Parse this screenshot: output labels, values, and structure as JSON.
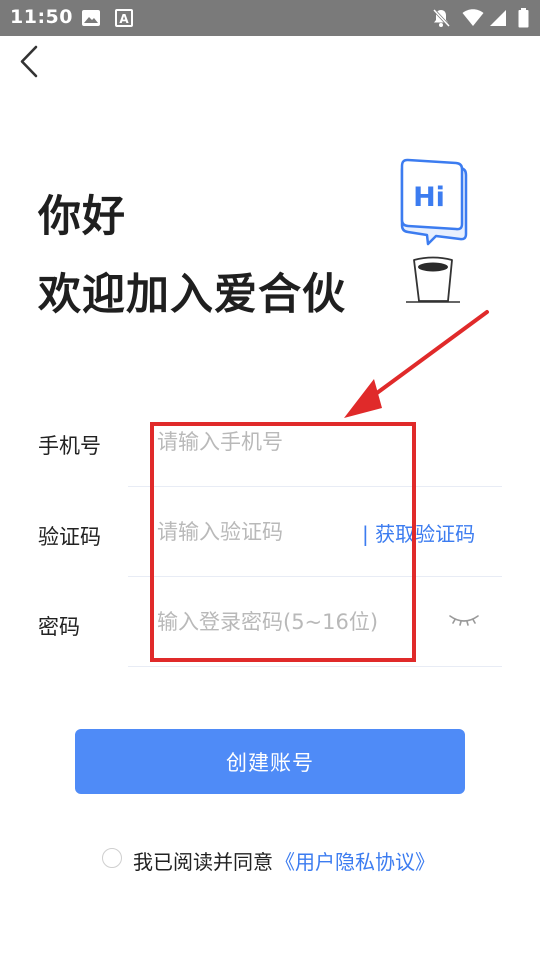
{
  "status_bar": {
    "time": "11:50",
    "left_icons": [
      "image-icon",
      "font-a-icon"
    ],
    "right_icons": [
      "notifications-off-icon",
      "wifi-icon",
      "cellular-signal-icon",
      "battery-icon"
    ],
    "background": "#7a7a7a"
  },
  "header": {
    "back_icon": "chevron-left-icon"
  },
  "greeting": {
    "line1": "你好",
    "line2": "欢迎加入爱合伙"
  },
  "illustration": {
    "bubble_text": "Hi",
    "bubble_icon": "speech-bubble-icon",
    "cup_icon": "coffee-cup-icon"
  },
  "form": {
    "phone": {
      "label": "手机号",
      "placeholder": "请输入手机号",
      "value": ""
    },
    "code": {
      "label": "验证码",
      "placeholder": "请输入验证码",
      "value": "",
      "get_code": "| 获取验证码"
    },
    "password": {
      "label": "密码",
      "placeholder": "输入登录密码(5~16位)",
      "value": "",
      "toggle_icon": "eye-closed-icon"
    }
  },
  "create_button": {
    "label": "创建账号"
  },
  "agreement": {
    "checked": false,
    "text": "我已阅读并同意",
    "link": "《用户隐私协议》"
  },
  "colors": {
    "accent": "#4f8bf7",
    "link": "#3c7cf0",
    "annotation_red": "#e02a2a"
  }
}
